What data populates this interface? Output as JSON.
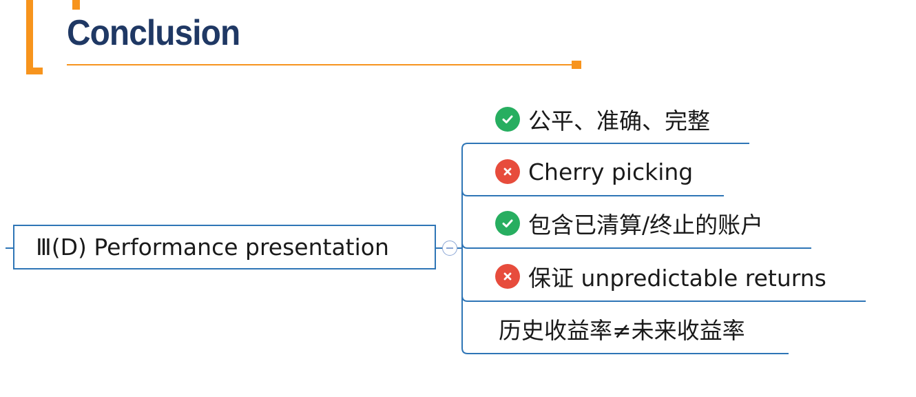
{
  "title": "Conclusion",
  "root": {
    "label": "Ⅲ(D) Performance presentation"
  },
  "branches": [
    {
      "label": "公平、准确、完整",
      "icon": "check-icon",
      "color": "#27ae60"
    },
    {
      "label": "Cherry picking",
      "icon": "cross-icon",
      "color": "#e74c3c"
    },
    {
      "label": "包含已清算/终止的账户",
      "icon": "check-icon",
      "color": "#27ae60"
    },
    {
      "label": "保证 unpredictable returns",
      "icon": "cross-icon",
      "color": "#e74c3c"
    },
    {
      "label": "历史收益率≠未来收益率",
      "icon": null,
      "color": null
    }
  ],
  "colors": {
    "accent": "#f7941d",
    "title": "#1f3864",
    "line": "#2e75b6"
  }
}
